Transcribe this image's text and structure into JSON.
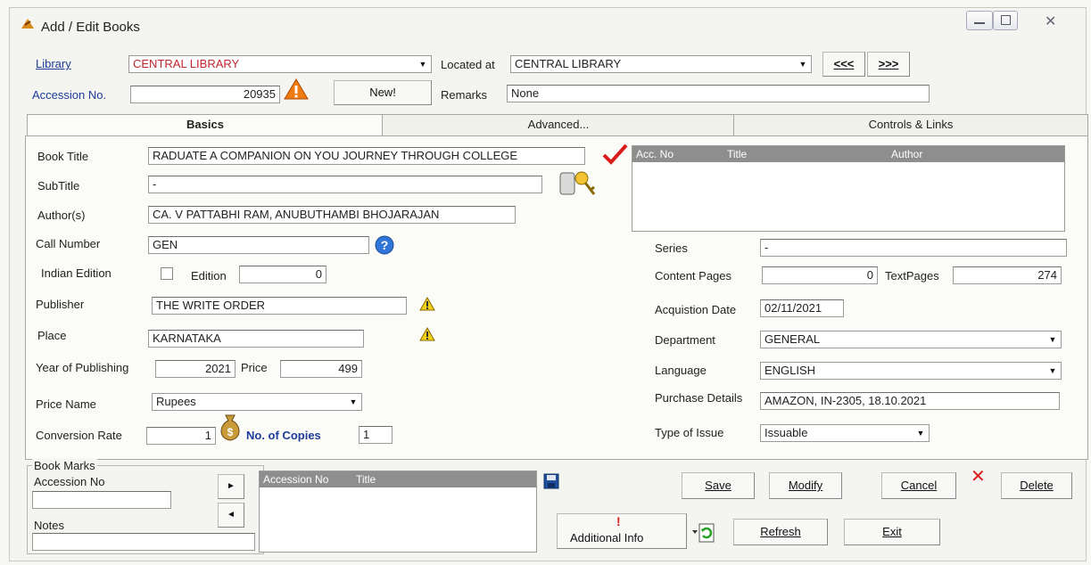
{
  "window": {
    "title": "Add / Edit Books"
  },
  "header": {
    "library_label": "Library",
    "library_value": "CENTRAL LIBRARY",
    "located_label": "Located at",
    "located_value": "CENTRAL LIBRARY",
    "prev_label": "<<<",
    "next_label": ">>>",
    "accession_label": "Accession No.",
    "accession_value": "20935",
    "new_label": "New!",
    "remarks_label": "Remarks",
    "remarks_value": "None"
  },
  "tabs": [
    "Basics",
    "Advanced...",
    "Controls & Links"
  ],
  "basics": {
    "book_title_label": "Book Title",
    "book_title_value": "RADUATE A COMPANION ON YOU JOURNEY THROUGH COLLEGE",
    "subtitle_label": "SubTitle",
    "subtitle_value": "-",
    "authors_label": "Author(s)",
    "authors_value": "CA. V PATTABHI RAM, ANUBUTHAMBI BHOJARAJAN",
    "call_number_label": "Call Number",
    "call_number_value": "GEN",
    "indian_edition_label": "Indian Edition",
    "edition_label": "Edition",
    "edition_value": "0",
    "publisher_label": "Publisher",
    "publisher_value": "THE WRITE ORDER",
    "place_label": "Place",
    "place_value": "KARNATAKA",
    "year_label": "Year of Publishing",
    "year_value": "2021",
    "price_label": "Price",
    "price_value": "499",
    "price_name_label": "Price Name",
    "price_name_value": "Rupees",
    "conversion_label": "Conversion Rate",
    "conversion_value": "1",
    "copies_label": "No. of Copies",
    "copies_value": "1"
  },
  "search_grid": {
    "columns": [
      "Acc. No",
      "Title",
      "Author"
    ]
  },
  "right": {
    "series_label": "Series",
    "series_value": "-",
    "content_pages_label": "Content Pages",
    "content_pages_value": "0",
    "text_pages_label": "TextPages",
    "text_pages_value": "274",
    "acq_date_label": "Acquistion Date",
    "acq_date_value": "02/11/2021",
    "department_label": "Department",
    "department_value": "GENERAL",
    "language_label": "Language",
    "language_value": "ENGLISH",
    "purchase_label": "Purchase Details",
    "purchase_value": "AMAZON, IN-2305, 18.10.2021",
    "issue_label": "Type of Issue",
    "issue_value": "Issuable"
  },
  "bookmarks": {
    "group_label": "Book Marks",
    "accession_label": "Accession No",
    "notes_label": "Notes",
    "add_arrow": "►",
    "remove_arrow": "◄",
    "columns": [
      "Accession No",
      "Title"
    ]
  },
  "actions": {
    "save": "Save",
    "modify": "Modify",
    "cancel": "Cancel",
    "delete": "Delete",
    "additional_info": "Additional Info",
    "refresh": "Refresh",
    "exit": "Exit"
  }
}
